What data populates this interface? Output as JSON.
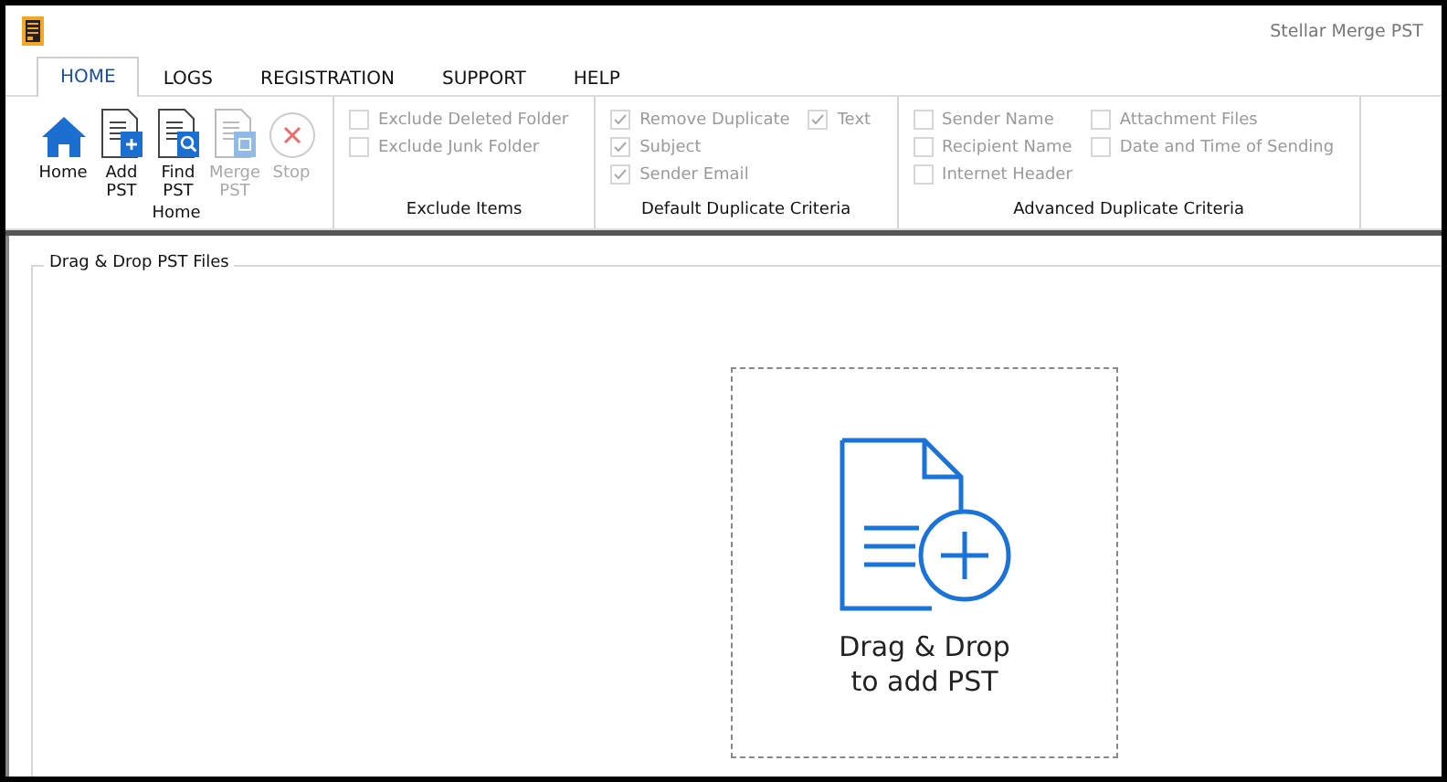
{
  "window": {
    "title": "Stellar Merge PST"
  },
  "tabs": [
    {
      "label": "HOME",
      "selected": true
    },
    {
      "label": "LOGS",
      "selected": false
    },
    {
      "label": "REGISTRATION",
      "selected": false
    },
    {
      "label": "SUPPORT",
      "selected": false
    },
    {
      "label": "HELP",
      "selected": false
    }
  ],
  "ribbon_groups": [
    {
      "kind": "buttons",
      "label": "Home",
      "buttons": [
        {
          "kind": "home",
          "label": "Home",
          "disabled": false
        },
        {
          "kind": "add",
          "label": "Add PST",
          "disabled": false
        },
        {
          "kind": "find",
          "label": "Find PST",
          "disabled": false
        },
        {
          "kind": "merge",
          "label": "Merge PST",
          "disabled": true
        },
        {
          "kind": "stop",
          "label": "Stop",
          "disabled": true
        }
      ]
    },
    {
      "kind": "checks",
      "label": "Exclude Items",
      "columns": [
        [
          {
            "label": "Exclude Deleted Folder",
            "checked": false,
            "disabled": true
          },
          {
            "label": "Exclude Junk Folder",
            "checked": false,
            "disabled": true
          }
        ]
      ]
    },
    {
      "kind": "checks",
      "label": "Default Duplicate Criteria",
      "columns": [
        [
          {
            "label": "Remove Duplicate",
            "checked": true,
            "disabled": true
          },
          {
            "label": "Subject",
            "checked": true,
            "disabled": true
          },
          {
            "label": "Sender Email",
            "checked": true,
            "disabled": true
          }
        ],
        [
          {
            "label": "Text",
            "checked": true,
            "disabled": true
          }
        ]
      ]
    },
    {
      "kind": "checks",
      "label": "Advanced Duplicate Criteria",
      "columns": [
        [
          {
            "label": "Sender Name",
            "checked": false,
            "disabled": true
          },
          {
            "label": "Recipient Name",
            "checked": false,
            "disabled": true
          },
          {
            "label": "Internet Header",
            "checked": false,
            "disabled": true
          }
        ],
        [
          {
            "label": "Attachment Files",
            "checked": false,
            "disabled": true
          },
          {
            "label": "Date and Time of Sending",
            "checked": false,
            "disabled": true
          }
        ]
      ]
    }
  ],
  "drop_area": {
    "title": "Drag & Drop PST Files",
    "prompt": "Drag & Drop\nto add PST"
  }
}
